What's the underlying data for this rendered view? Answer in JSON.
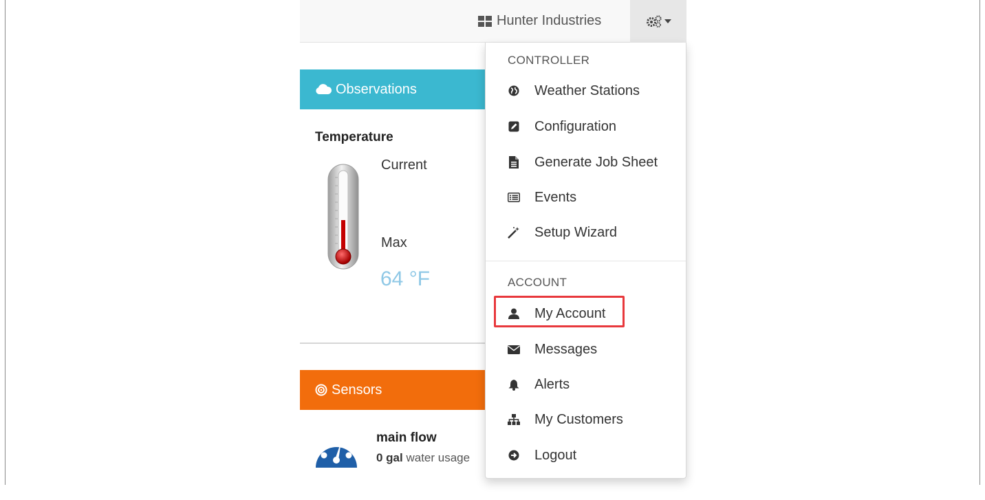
{
  "navbar": {
    "brand_label": "Hunter Industries",
    "brand_icon": "grid-icon",
    "settings_icon": "gears-icon"
  },
  "observations": {
    "title": "Observations",
    "icon": "cloud-icon",
    "color": "#3bb8d0",
    "temperature_title": "Temperature",
    "current_label": "Current",
    "max_label": "Max",
    "max_value": "64 °F"
  },
  "sensors": {
    "title": "Sensors",
    "icon": "target-icon",
    "color": "#f26d0c",
    "sensor_name": "main flow",
    "usage_amount": "0 gal",
    "usage_text": " water usage"
  },
  "menu": {
    "controller_header": "CONTROLLER",
    "controller_items": [
      {
        "label": "Weather Stations",
        "icon": "globe-icon"
      },
      {
        "label": "Configuration",
        "icon": "edit-icon"
      },
      {
        "label": "Generate Job Sheet",
        "icon": "file-icon"
      },
      {
        "label": "Events",
        "icon": "list-icon"
      },
      {
        "label": "Setup Wizard",
        "icon": "magic-wand-icon"
      }
    ],
    "account_header": "ACCOUNT",
    "account_items": [
      {
        "label": "My Account",
        "icon": "user-icon"
      },
      {
        "label": "Messages",
        "icon": "envelope-icon"
      },
      {
        "label": "Alerts",
        "icon": "bell-icon"
      },
      {
        "label": "My Customers",
        "icon": "sitemap-icon"
      },
      {
        "label": "Logout",
        "icon": "logout-icon"
      }
    ],
    "highlight_color": "#e8383c"
  }
}
